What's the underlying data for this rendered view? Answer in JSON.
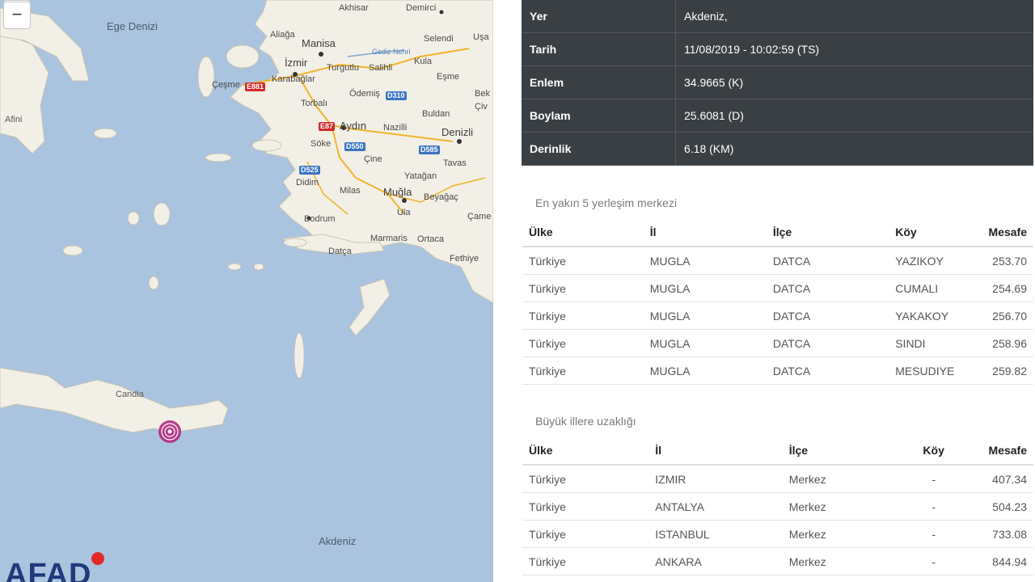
{
  "map": {
    "zoom_in": "+",
    "zoom_out": "−",
    "logo": "AFAD",
    "labels": {
      "ege_denizi": "Ege Denizi",
      "akdeniz": "Akdeniz",
      "candia": "Candia",
      "afini": "Afini",
      "manisa": "Manisa",
      "izmir": "İzmir",
      "aydin": "Aydın",
      "denizli": "Denizli",
      "mugla": "Muğla",
      "bodrum": "Bodrum",
      "cesme": "Çeşme",
      "karabaglar": "Karabağlar",
      "torbali": "Torbalı",
      "odemis": "Ödemiş",
      "turgutlu": "Turgutlu",
      "salihli": "Salihli",
      "kula": "Kula",
      "esme": "Eşme",
      "selendi": "Selendi",
      "demirci": "Demirci",
      "akhisar": "Akhisar",
      "aliaga": "Aliağa",
      "nazilli": "Nazilli",
      "buldan": "Buldan",
      "soke": "Söke",
      "didim": "Didim",
      "milas": "Milas",
      "cine": "Çine",
      "yatagan": "Yatağan",
      "tavas": "Tavas",
      "beyagac": "Beyağaç",
      "ula": "Ula",
      "marmaris": "Marmaris",
      "ortaca": "Ortaca",
      "datca": "Datça",
      "fethiye": "Fethiye",
      "came": "Çame",
      "gediz": "Gediz Nehri",
      "usak_partial": "Uşa",
      "bek_partial": "Bek",
      "civ_partial": "Çiv"
    },
    "shields": {
      "e881": "E881",
      "e87": "E87",
      "d310": "D310",
      "d550": "D550",
      "d585": "D585",
      "d525": "D525"
    }
  },
  "info": {
    "rows": [
      {
        "key": "Yer",
        "value": "Akdeniz,"
      },
      {
        "key": "Tarih",
        "value": "11/08/2019 - 10:02:59 (TS)"
      },
      {
        "key": "Enlem",
        "value": "34.9665 (K)"
      },
      {
        "key": "Boylam",
        "value": "25.6081 (D)"
      },
      {
        "key": "Derinlik",
        "value": "6.18 (KM)"
      }
    ]
  },
  "nearest": {
    "title": "En yakın 5 yerleşim merkezi",
    "headers": [
      "Ülke",
      "İl",
      "İlçe",
      "Köy",
      "Mesafe"
    ],
    "rows": [
      [
        "Türkiye",
        "MUGLA",
        "DATCA",
        "YAZIKOY",
        "253.70"
      ],
      [
        "Türkiye",
        "MUGLA",
        "DATCA",
        "CUMALI",
        "254.69"
      ],
      [
        "Türkiye",
        "MUGLA",
        "DATCA",
        "YAKAKOY",
        "256.70"
      ],
      [
        "Türkiye",
        "MUGLA",
        "DATCA",
        "SINDI",
        "258.96"
      ],
      [
        "Türkiye",
        "MUGLA",
        "DATCA",
        "MESUDIYE",
        "259.82"
      ]
    ]
  },
  "cities": {
    "title": "Büyük illere uzaklığı",
    "headers": [
      "Ülke",
      "İl",
      "İlçe",
      "Köy",
      "Mesafe"
    ],
    "rows": [
      [
        "Türkiye",
        "IZMIR",
        "Merkez",
        "-",
        "407.34"
      ],
      [
        "Türkiye",
        "ANTALYA",
        "Merkez",
        "-",
        "504.23"
      ],
      [
        "Türkiye",
        "ISTANBUL",
        "Merkez",
        "-",
        "733.08"
      ],
      [
        "Türkiye",
        "ANKARA",
        "Merkez",
        "-",
        "844.94"
      ]
    ]
  }
}
